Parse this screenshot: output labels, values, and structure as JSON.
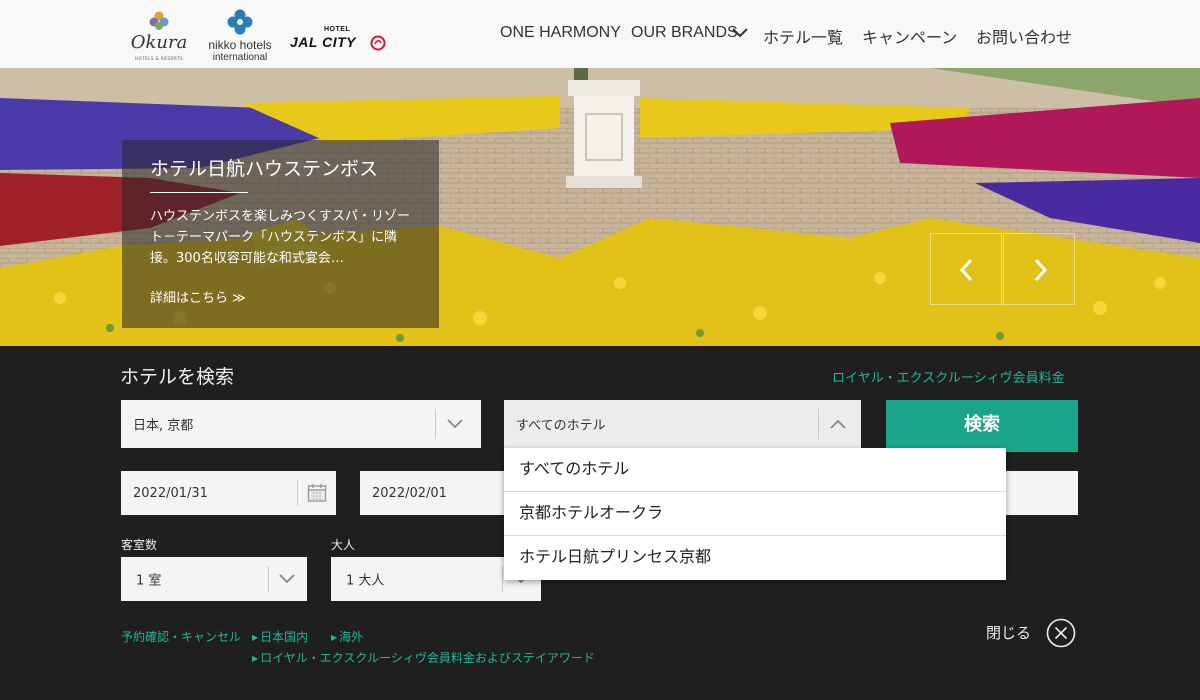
{
  "header": {
    "brands": {
      "okura": {
        "name": "Okura",
        "sub": "HOTELS & RESORTS"
      },
      "nikko": {
        "name": "nikko hotels",
        "sub": "international"
      },
      "jalcity": {
        "hotel": "HOTEL",
        "name": "JAL CITY"
      }
    },
    "nav": [
      "ONE HARMONY",
      "OUR BRANDS",
      "ホテル一覧",
      "キャンペーン",
      "お問い合わせ"
    ]
  },
  "hero": {
    "title": "ホテル日航ハウステンボス",
    "description": "ハウステンボスを楽しみつくすスパ・リゾート－テーマパーク「ハウステンボス」に隣接。300名収容可能な和式宴会…",
    "more_label": "詳細はこちら ≫"
  },
  "search": {
    "title": "ホテルを検索",
    "royal_link": "ロイヤル・エクスクルーシィヴ会員料金",
    "area_value": "日本, 京都",
    "hotel_value": "すべてのホテル",
    "search_button": "検索",
    "checkin": "2022/01/31",
    "checkout": "2022/02/01",
    "rooms_label": "客室数",
    "rooms_value": "1 室",
    "adults_label": "大人",
    "adults_value": "1 大人",
    "hotel_options": [
      "すべてのホテル",
      "京都ホテルオークラ",
      "ホテル日航プリンセス京都"
    ],
    "links": {
      "reservation": "予約確認・キャンセル",
      "domestic": "日本国内",
      "overseas": "海外",
      "royal_stay": "ロイヤル・エクスクルーシィヴ会員料金およびステイアワード"
    },
    "close_label": "閉じる"
  },
  "colors": {
    "accent": "#1aa58a",
    "link": "#22b59a",
    "panel_bg": "#1f1f1f"
  }
}
